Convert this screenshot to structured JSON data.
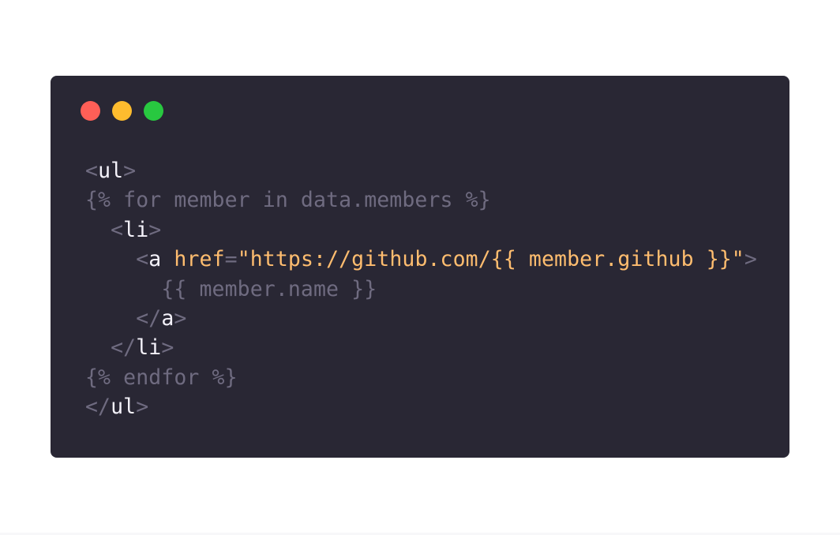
{
  "window": {
    "controls": [
      {
        "name": "close",
        "color": "#ff5f57"
      },
      {
        "name": "minimize",
        "color": "#febc2e"
      },
      {
        "name": "zoom",
        "color": "#28c840"
      }
    ]
  },
  "colors": {
    "background": "#292734",
    "page": "#ffffff",
    "punctuation": "#6f6b80",
    "tag": "#f4f2fa",
    "attribute": "#ffbd6f",
    "string": "#ffbd6f",
    "template": "#6f6b80"
  },
  "code": {
    "lines": [
      {
        "tokens": [
          {
            "t": "<",
            "k": "punctuation"
          },
          {
            "t": "ul",
            "k": "tag"
          },
          {
            "t": ">",
            "k": "punctuation"
          }
        ]
      },
      {
        "tokens": [
          {
            "t": "{% for member in data.members %}",
            "k": "template"
          }
        ]
      },
      {
        "tokens": [
          {
            "t": "  ",
            "k": "tag"
          },
          {
            "t": "<",
            "k": "punctuation"
          },
          {
            "t": "li",
            "k": "tag"
          },
          {
            "t": ">",
            "k": "punctuation"
          }
        ]
      },
      {
        "tokens": [
          {
            "t": "    ",
            "k": "tag"
          },
          {
            "t": "<",
            "k": "punctuation"
          },
          {
            "t": "a",
            "k": "tag"
          },
          {
            "t": " ",
            "k": "tag"
          },
          {
            "t": "href",
            "k": "attribute"
          },
          {
            "t": "=",
            "k": "punctuation"
          },
          {
            "t": "\"https://github.com/{{ member.github }}\"",
            "k": "string"
          },
          {
            "t": ">",
            "k": "punctuation"
          }
        ]
      },
      {
        "tokens": [
          {
            "t": "      ",
            "k": "tag"
          },
          {
            "t": "{{ member.name }}",
            "k": "template"
          }
        ]
      },
      {
        "tokens": [
          {
            "t": "    ",
            "k": "tag"
          },
          {
            "t": "</",
            "k": "punctuation"
          },
          {
            "t": "a",
            "k": "tag"
          },
          {
            "t": ">",
            "k": "punctuation"
          }
        ]
      },
      {
        "tokens": [
          {
            "t": "  ",
            "k": "tag"
          },
          {
            "t": "</",
            "k": "punctuation"
          },
          {
            "t": "li",
            "k": "tag"
          },
          {
            "t": ">",
            "k": "punctuation"
          }
        ]
      },
      {
        "tokens": [
          {
            "t": "{% endfor %}",
            "k": "template"
          }
        ]
      },
      {
        "tokens": [
          {
            "t": "</",
            "k": "punctuation"
          },
          {
            "t": "ul",
            "k": "tag"
          },
          {
            "t": ">",
            "k": "punctuation"
          }
        ]
      }
    ]
  }
}
